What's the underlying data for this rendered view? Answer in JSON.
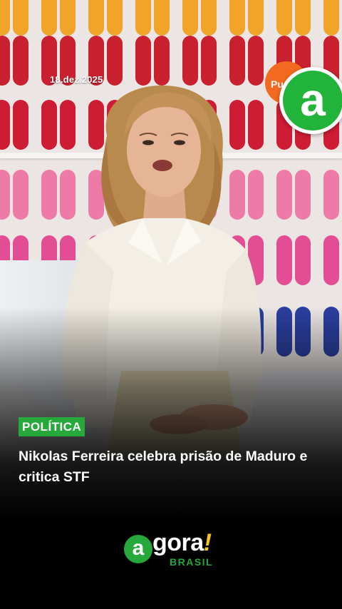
{
  "video": {
    "date": "18.dez.2025",
    "channel_badge_text": "Pu"
  },
  "brand": {
    "corner_letter": "a",
    "logo_word": "gora",
    "logo_letter": "a",
    "logo_bang": "!",
    "logo_sub": "BRASIL",
    "green": "#26a83a",
    "yellow": "#f5c518"
  },
  "story": {
    "category": "POLÍTICA",
    "headline": "Nikolas Ferreira celebra prisão de Maduro e critica STF"
  },
  "wall_colors": {
    "row1": "#f0a528",
    "row2": "#c8202e",
    "row3": "#ce1c34",
    "row4": "#ee7aa8",
    "row5": "#e24d94",
    "row6": "#2b3fa0"
  }
}
